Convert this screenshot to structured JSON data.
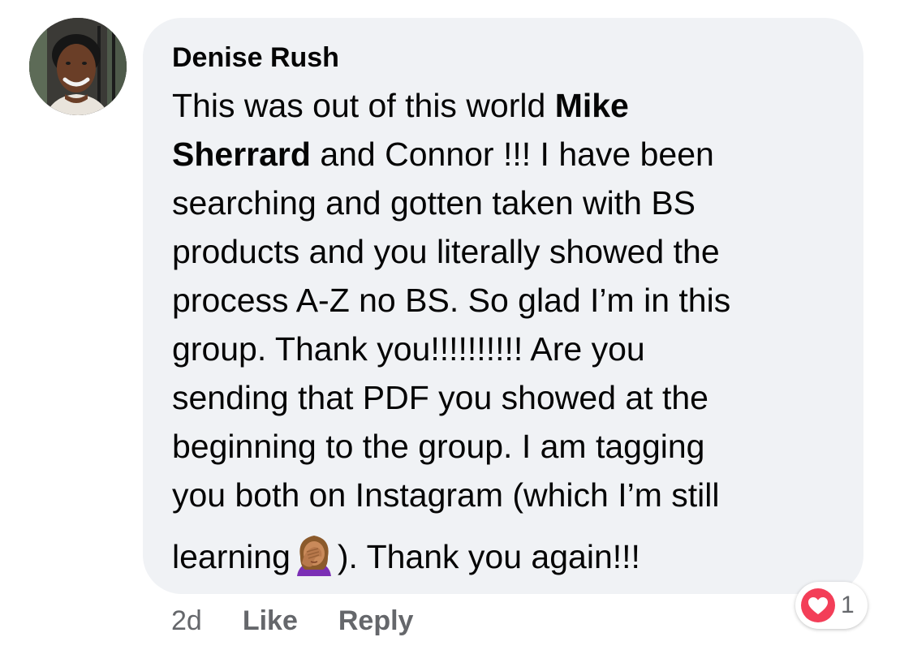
{
  "comment": {
    "author": "Denise Rush",
    "text_lines": [
      [
        {
          "t": "This was out of this world "
        },
        {
          "t": "Mike",
          "b": true
        }
      ],
      [
        {
          "t": "Sherrard",
          "b": true
        },
        {
          "t": " and Connor !!! I have been"
        }
      ],
      [
        {
          "t": "searching and gotten taken with BS"
        }
      ],
      [
        {
          "t": "products and you literally showed the"
        }
      ],
      [
        {
          "t": "process A-Z no BS. So glad I’m in this"
        }
      ],
      [
        {
          "t": "group. Thank you!!!!!!!!!! Are you"
        }
      ],
      [
        {
          "t": "sending that PDF you showed at the"
        }
      ],
      [
        {
          "t": "beginning to the group. I am tagging"
        }
      ],
      [
        {
          "t": "you both on Instagram (which I’m still"
        }
      ]
    ],
    "last_line_before_emoji": "learning",
    "last_line_after_emoji": "). Thank you again!!!",
    "emoji": "woman-facepalming-icon"
  },
  "actions": {
    "timestamp": "2d",
    "like_label": "Like",
    "reply_label": "Reply"
  },
  "reactions": {
    "icon": "heart-icon",
    "count": "1",
    "color": "#f33e58"
  }
}
